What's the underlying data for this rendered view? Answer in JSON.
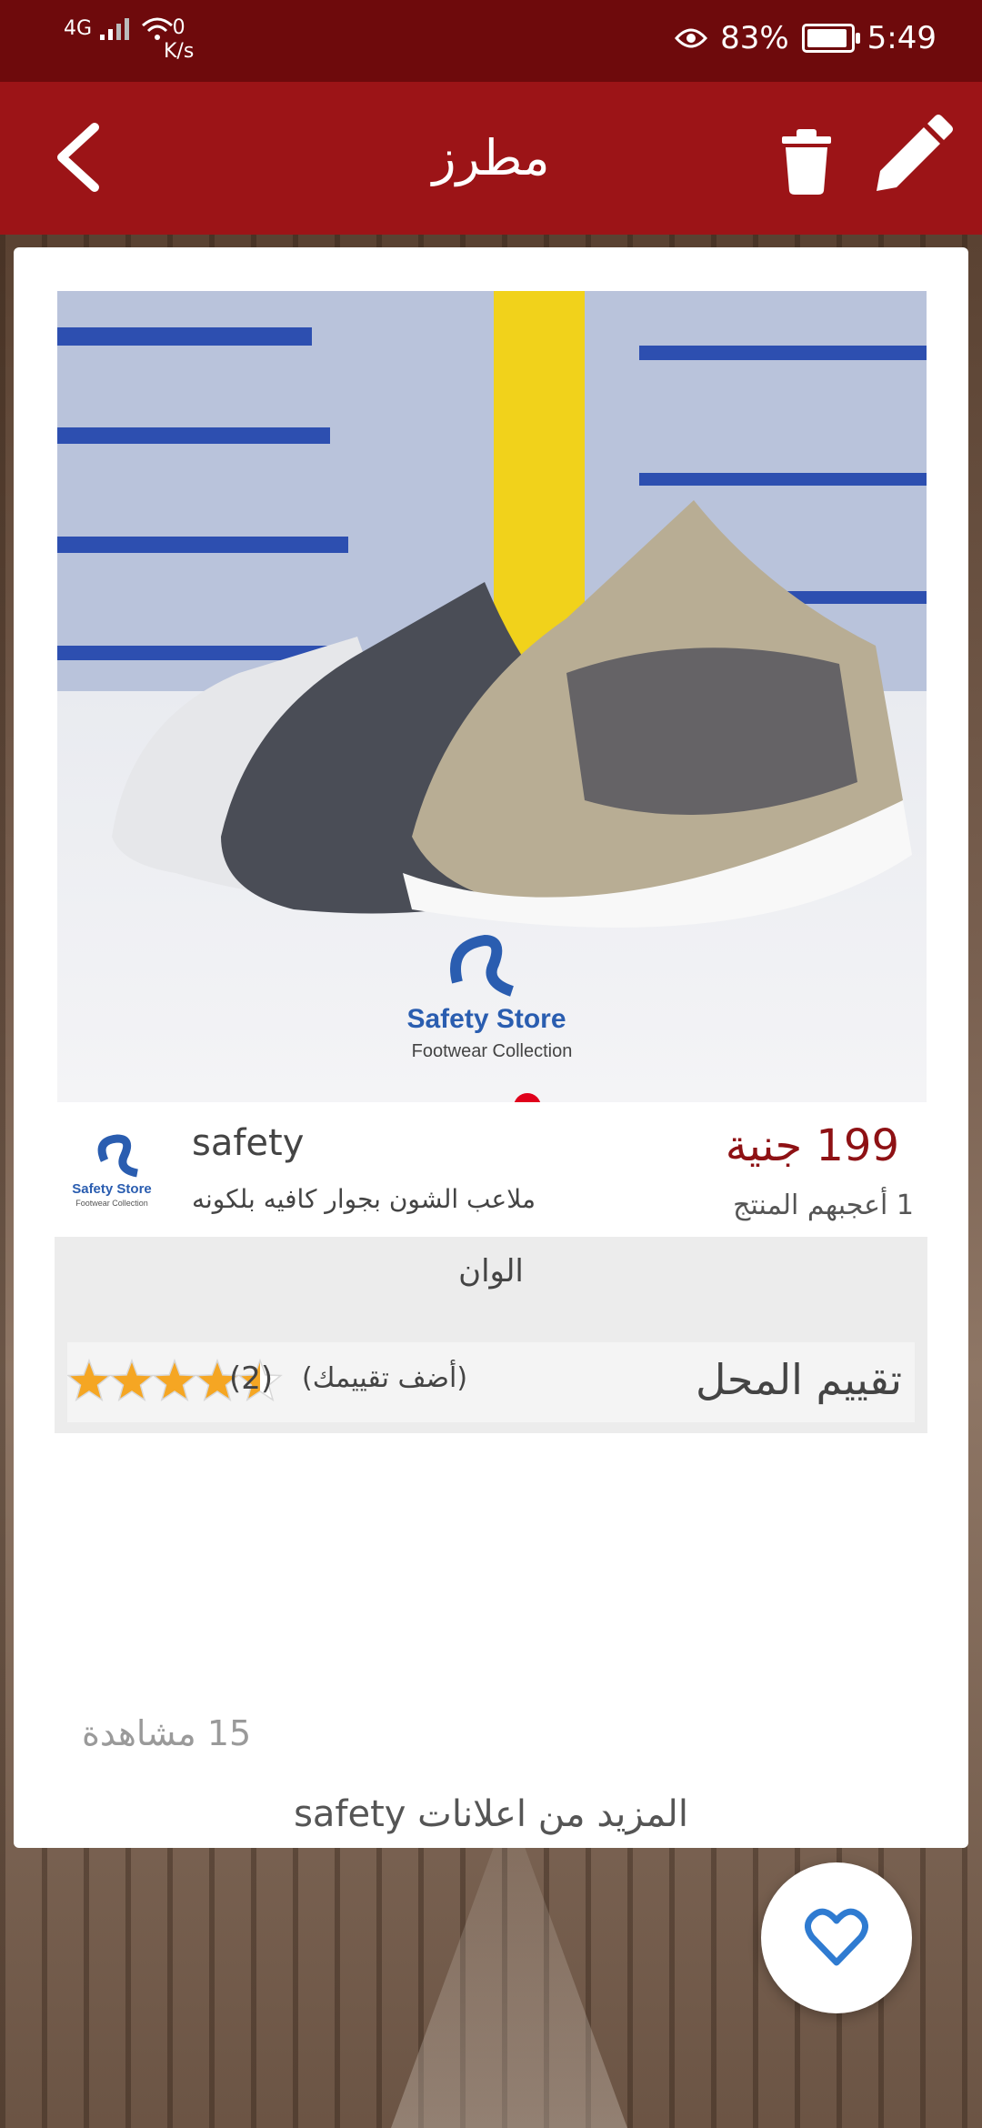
{
  "status_bar": {
    "network": "4G",
    "speed_value": "0",
    "speed_unit": "K/s",
    "battery": "83%",
    "time": "5:49"
  },
  "app_bar": {
    "title": "مطرز"
  },
  "product": {
    "seller": "safety",
    "address": "ملاعب الشون بجوار كافيه بلكونه",
    "price": "199 جنية",
    "likes": "1 أعجبهم المنتج",
    "logo_text": "Safety Store",
    "logo_subtext": "Footwear Collection",
    "image_brand": "Safety Store",
    "image_subtext": "Footwear Collection"
  },
  "colors_label": "الوان",
  "rating": {
    "title": "تقييم المحل",
    "add_label": "(أضف تقييمك)",
    "count": "(2)",
    "stars": 4.5,
    "star_color": "#f5a623"
  },
  "views": "15 مشاهدة",
  "more_from": "المزيد من اعلانات safety",
  "accent": "#9c1417"
}
